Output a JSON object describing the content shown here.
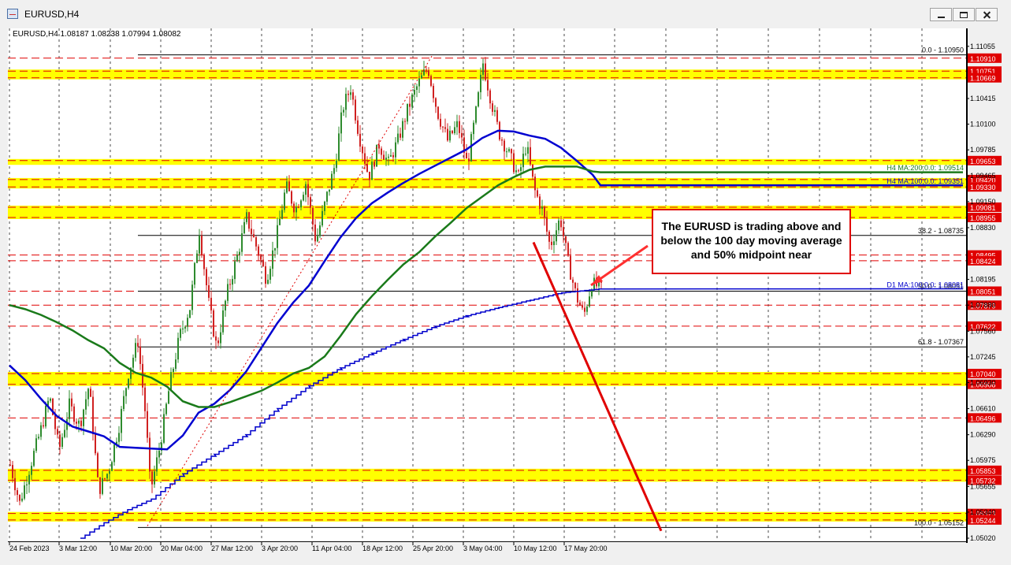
{
  "window": {
    "title": "EURUSD,H4"
  },
  "chart_header": "EURUSD,H4  1.08187 1.08238 1.07994 1.08082",
  "annotation": {
    "text": "The EURUSD is trading above and below the 100 day moving average and 50% midpoint near"
  },
  "colors": {
    "red_level": "#e00000",
    "yellow_zone": "#ffff00",
    "ma_100_h4": "#0000d0",
    "ma_200_h4": "#1a7a1a",
    "ma_100_d1": "#0000cc",
    "fib_line": "#000000",
    "bull_candle": "#2e8b2e",
    "bear_candle": "#d02020"
  },
  "chart_data": {
    "type": "candlestick",
    "symbol": "EURUSD",
    "timeframe": "H4",
    "ylim": [
      1.0502,
      1.1114
    ],
    "y_ticks": [
      "1.11055",
      "1.10415",
      "1.10100",
      "1.09785",
      "1.09465",
      "1.09150",
      "1.08830",
      "1.08195",
      "1.07880",
      "1.07560",
      "1.07245",
      "1.06930",
      "1.06610",
      "1.06290",
      "1.05975",
      "1.05655",
      "1.05340",
      "1.05020"
    ],
    "x_ticks": [
      "24 Feb 2023",
      "3 Mar 12:00",
      "10 Mar 20:00",
      "20 Mar 04:00",
      "27 Mar 12:00",
      "3 Apr 20:00",
      "11 Apr 04:00",
      "18 Apr 12:00",
      "25 Apr 20:00",
      "3 May 04:00",
      "10 May 12:00",
      "17 May 20:00"
    ],
    "levels": [
      {
        "price": 1.1091,
        "label": "1.10910"
      },
      {
        "price": 1.10751,
        "label": "1.10751"
      },
      {
        "price": 1.10669,
        "label": "1.10669"
      },
      {
        "price": 1.09653,
        "label": "1.09653"
      },
      {
        "price": 1.0942,
        "label": "1.09420"
      },
      {
        "price": 1.0933,
        "label": "1.09330"
      },
      {
        "price": 1.09081,
        "label": "1.09081"
      },
      {
        "price": 1.08955,
        "label": "1.08955"
      },
      {
        "price": 1.08495,
        "label": "1.08495"
      },
      {
        "price": 1.08424,
        "label": "1.08424"
      },
      {
        "price": 1.08051,
        "label": "1.08051"
      },
      {
        "price": 1.07879,
        "label": "1.07879"
      },
      {
        "price": 1.07622,
        "label": "1.07622"
      },
      {
        "price": 1.0704,
        "label": "1.07040"
      },
      {
        "price": 1.06908,
        "label": "1.06908"
      },
      {
        "price": 1.06496,
        "label": "1.06496"
      },
      {
        "price": 1.05853,
        "label": "1.05853"
      },
      {
        "price": 1.05732,
        "label": "1.05732"
      },
      {
        "price": 1.05323,
        "label": "1.05323"
      },
      {
        "price": 1.05244,
        "label": "1.05244"
      }
    ],
    "zones": [
      {
        "top": 1.10751,
        "bottom": 1.10669
      },
      {
        "top": 1.09653,
        "bottom": 1.0962
      },
      {
        "top": 1.0942,
        "bottom": 1.0933
      },
      {
        "top": 1.09081,
        "bottom": 1.08955
      },
      {
        "top": 1.0704,
        "bottom": 1.06908
      },
      {
        "top": 1.05853,
        "bottom": 1.05732
      },
      {
        "top": 1.05323,
        "bottom": 1.05244
      }
    ],
    "fib_levels": [
      {
        "price": 1.1095,
        "label": "0.0 - 1.10950"
      },
      {
        "price": 1.08735,
        "label": "38.2 - 1.08735"
      },
      {
        "price": 1.08051,
        "label": "50.0 - 1.08051"
      },
      {
        "price": 1.07367,
        "label": "61.8 - 1.07367"
      },
      {
        "price": 1.05152,
        "label": "100.0 - 1.05152"
      }
    ],
    "ma_labels": [
      {
        "text": "H4 MA:200;0.0: 1.09514",
        "value": 1.09514
      },
      {
        "text": "H4 MA:100;0.0: 1.09351",
        "value": 1.09351
      },
      {
        "text": "D1 MA:100;0.0: 1.08081",
        "value": 1.08081
      }
    ],
    "series": [
      {
        "name": "H4 MA:100",
        "points": [
          [
            0,
            1.0714
          ],
          [
            20,
            1.0696
          ],
          [
            40,
            1.0673
          ],
          [
            60,
            1.0652
          ],
          [
            80,
            1.0639
          ],
          [
            100,
            1.0633
          ],
          [
            120,
            1.0627
          ],
          [
            140,
            1.0614
          ],
          [
            160,
            1.0613
          ],
          [
            180,
            1.0612
          ],
          [
            200,
            1.0611
          ],
          [
            220,
            1.0628
          ],
          [
            240,
            1.0656
          ],
          [
            260,
            1.0667
          ],
          [
            280,
            1.0684
          ],
          [
            300,
            1.0706
          ],
          [
            320,
            1.0736
          ],
          [
            340,
            1.0766
          ],
          [
            360,
            1.0791
          ],
          [
            380,
            1.0812
          ],
          [
            400,
            1.0842
          ],
          [
            420,
            1.0871
          ],
          [
            440,
            1.0895
          ],
          [
            460,
            1.0913
          ],
          [
            480,
            1.0926
          ],
          [
            500,
            1.0938
          ],
          [
            520,
            1.0949
          ],
          [
            540,
            1.0959
          ],
          [
            560,
            1.0969
          ],
          [
            580,
            1.0979
          ],
          [
            600,
            1.0993
          ],
          [
            620,
            1.1002
          ],
          [
            640,
            1.1001
          ],
          [
            660,
            1.0996
          ],
          [
            680,
            1.0992
          ],
          [
            700,
            1.0981
          ],
          [
            720,
            1.0965
          ],
          [
            740,
            1.0948
          ],
          [
            750,
            1.0935
          ]
        ]
      },
      {
        "name": "H4 MA:200",
        "points": [
          [
            0,
            1.0788
          ],
          [
            20,
            1.0783
          ],
          [
            40,
            1.0776
          ],
          [
            60,
            1.0767
          ],
          [
            80,
            1.0757
          ],
          [
            100,
            1.0745
          ],
          [
            120,
            1.0735
          ],
          [
            140,
            1.0717
          ],
          [
            160,
            1.0705
          ],
          [
            180,
            1.0699
          ],
          [
            200,
            1.0688
          ],
          [
            220,
            1.067
          ],
          [
            240,
            1.0663
          ],
          [
            260,
            1.0663
          ],
          [
            280,
            1.0669
          ],
          [
            300,
            1.0676
          ],
          [
            320,
            1.0683
          ],
          [
            340,
            1.0693
          ],
          [
            360,
            1.0704
          ],
          [
            380,
            1.0711
          ],
          [
            400,
            1.0725
          ],
          [
            420,
            1.075
          ],
          [
            440,
            1.0777
          ],
          [
            460,
            1.0799
          ],
          [
            480,
            1.0819
          ],
          [
            500,
            1.0838
          ],
          [
            520,
            1.0853
          ],
          [
            540,
            1.0872
          ],
          [
            560,
            1.0889
          ],
          [
            580,
            1.0907
          ],
          [
            600,
            1.0921
          ],
          [
            620,
            1.0935
          ],
          [
            640,
            1.0945
          ],
          [
            660,
            1.0954
          ],
          [
            680,
            1.0958
          ],
          [
            700,
            1.0958
          ],
          [
            720,
            1.0958
          ],
          [
            740,
            1.0952
          ],
          [
            750,
            1.0951
          ]
        ]
      },
      {
        "name": "D1 MA:100",
        "points": [
          [
            90,
            1.0502
          ],
          [
            120,
            1.0521
          ],
          [
            150,
            1.0537
          ],
          [
            180,
            1.055
          ],
          [
            220,
            1.0581
          ],
          [
            260,
            1.0605
          ],
          [
            300,
            1.0629
          ],
          [
            340,
            1.0661
          ],
          [
            380,
            1.0689
          ],
          [
            420,
            1.0711
          ],
          [
            460,
            1.0729
          ],
          [
            500,
            1.0746
          ],
          [
            540,
            1.0762
          ],
          [
            580,
            1.0775
          ],
          [
            620,
            1.0785
          ],
          [
            660,
            1.0794
          ],
          [
            700,
            1.0803
          ],
          [
            750,
            1.0808
          ]
        ]
      }
    ],
    "trendlines": [
      {
        "from": [
          175,
          1.0517
        ],
        "to": [
          537,
          1.1095
        ]
      },
      {
        "from": [
          665,
          1.0865
        ],
        "to": [
          827,
          1.0511
        ]
      }
    ],
    "candles_key": [
      [
        0,
        1.0592
      ],
      [
        12,
        1.0545
      ],
      [
        25,
        1.059
      ],
      [
        38,
        1.0632
      ],
      [
        50,
        1.0676
      ],
      [
        62,
        1.061
      ],
      [
        75,
        1.0665
      ],
      [
        88,
        1.064
      ],
      [
        100,
        1.069
      ],
      [
        112,
        1.056
      ],
      [
        125,
        1.0585
      ],
      [
        138,
        1.064
      ],
      [
        150,
        1.0705
      ],
      [
        162,
        1.0744
      ],
      [
        172,
        1.065
      ],
      [
        178,
        1.056
      ],
      [
        190,
        1.0615
      ],
      [
        202,
        1.0688
      ],
      [
        215,
        1.075
      ],
      [
        228,
        1.0785
      ],
      [
        240,
        1.088
      ],
      [
        252,
        1.079
      ],
      [
        262,
        1.0735
      ],
      [
        275,
        1.0802
      ],
      [
        288,
        1.0848
      ],
      [
        300,
        1.0895
      ],
      [
        315,
        1.0852
      ],
      [
        325,
        1.082
      ],
      [
        338,
        1.0872
      ],
      [
        350,
        1.0934
      ],
      [
        362,
        1.0905
      ],
      [
        375,
        1.0938
      ],
      [
        388,
        1.0865
      ],
      [
        400,
        1.0915
      ],
      [
        412,
        1.096
      ],
      [
        422,
        1.103
      ],
      [
        432,
        1.1055
      ],
      [
        442,
        1.1
      ],
      [
        455,
        1.0945
      ],
      [
        468,
        1.0985
      ],
      [
        480,
        1.0962
      ],
      [
        492,
        1.099
      ],
      [
        505,
        1.103
      ],
      [
        518,
        1.106
      ],
      [
        530,
        1.108
      ],
      [
        542,
        1.1025
      ],
      [
        555,
        1.099
      ],
      [
        568,
        1.101
      ],
      [
        580,
        1.096
      ],
      [
        592,
        1.103
      ],
      [
        600,
        1.1085
      ],
      [
        610,
        1.104
      ],
      [
        620,
        1.1
      ],
      [
        632,
        1.0975
      ],
      [
        645,
        1.0945
      ],
      [
        655,
        1.0985
      ],
      [
        665,
        1.093
      ],
      [
        675,
        1.0905
      ],
      [
        685,
        1.086
      ],
      [
        698,
        1.0895
      ],
      [
        708,
        1.084
      ],
      [
        718,
        1.08
      ],
      [
        728,
        1.0775
      ],
      [
        738,
        1.0815
      ],
      [
        750,
        1.0808
      ]
    ]
  }
}
